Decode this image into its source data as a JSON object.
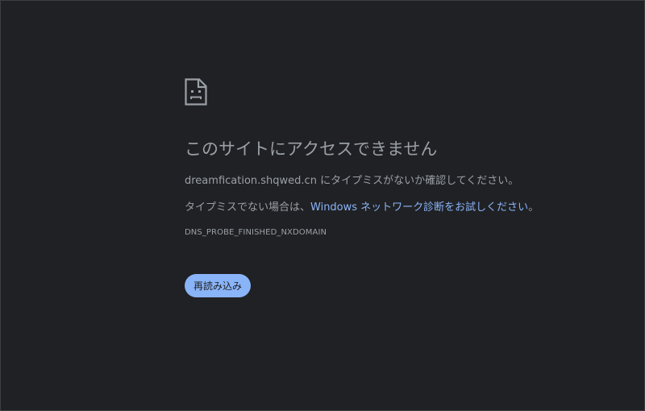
{
  "error_page": {
    "title": "このサイトにアクセスできません",
    "domain": "dreamfication.shqwed.cn",
    "domain_suffix": " にタイプミスがないか確認してください。",
    "suggestion_prefix": "タイプミスでない場合は、",
    "diagnostics_link": "Windows ネットワーク診断をお試しください",
    "suggestion_suffix": "。",
    "error_code": "DNS_PROBE_FINISHED_NXDOMAIN",
    "reload_button": "再読み込み"
  },
  "icon": {
    "name": "sad-page-icon",
    "color": "#9aa0a6"
  },
  "colors": {
    "background": "#202124",
    "text": "#9aa0a6",
    "link": "#8ab4f8",
    "button_bg": "#8ab4f8",
    "button_text": "#202124"
  }
}
